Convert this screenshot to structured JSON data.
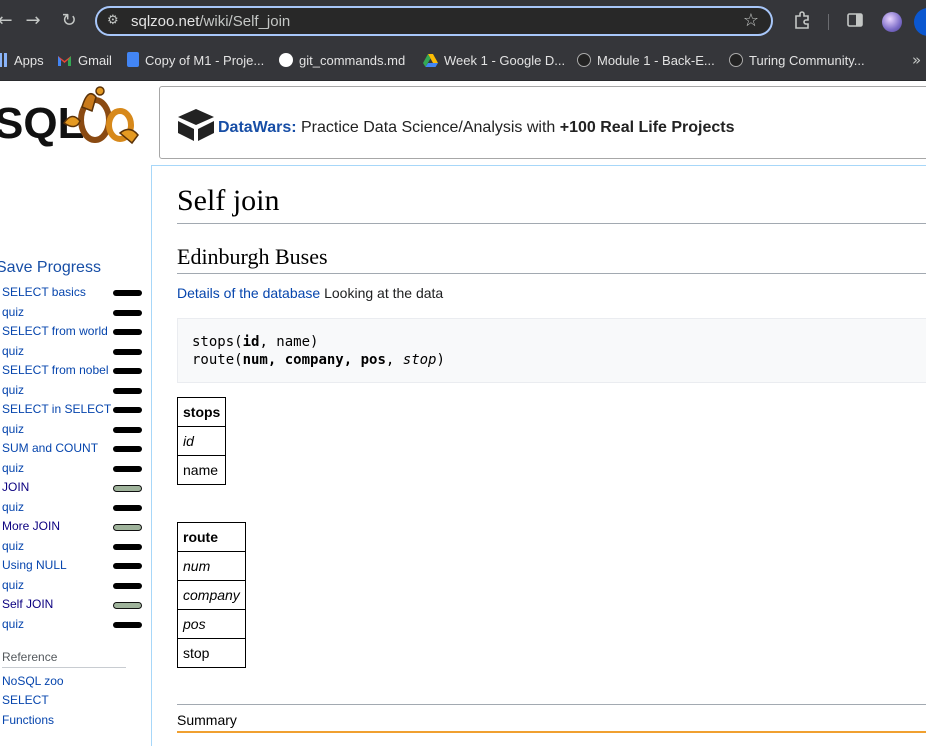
{
  "browser": {
    "url_host": "sqlzoo.net",
    "url_path": "/wiki/Self_join"
  },
  "bookmarks": [
    {
      "label": "Apps",
      "icon": "apps-grid-icon",
      "color": "#8ab4f8"
    },
    {
      "label": "Gmail",
      "icon": "gmail-icon",
      "color": "#ea4335"
    },
    {
      "label": "Copy of M1 - Proje...",
      "icon": "google-docs-icon",
      "color": "#4285f4"
    },
    {
      "label": "git_commands.md",
      "icon": "github-icon",
      "color": "#ffffff"
    },
    {
      "label": "Week 1 - Google D...",
      "icon": "google-drive-icon",
      "color": "#fbbc04"
    },
    {
      "label": "Module 1 - Back-E...",
      "icon": "turing-icon",
      "color": "#222222"
    },
    {
      "label": "Turing Community...",
      "icon": "turing-icon",
      "color": "#222222"
    }
  ],
  "banner": {
    "brand": "DataWars:",
    "text": " Practice Data Science/Analysis with ",
    "bold": "+100 Real Life Projects"
  },
  "sidebar": {
    "save_progress": "Save Progress",
    "items": [
      {
        "label": "SELECT basics",
        "status": "done"
      },
      {
        "label": "quiz",
        "status": "done"
      },
      {
        "label": "SELECT from world",
        "status": "done"
      },
      {
        "label": "quiz",
        "status": "done"
      },
      {
        "label": "SELECT from nobel",
        "status": "done"
      },
      {
        "label": "quiz",
        "status": "done"
      },
      {
        "label": "SELECT in SELECT",
        "status": "done"
      },
      {
        "label": "quiz",
        "status": "done"
      },
      {
        "label": "SUM and COUNT",
        "status": "done"
      },
      {
        "label": "quiz",
        "status": "done"
      },
      {
        "label": "JOIN",
        "status": "partial"
      },
      {
        "label": "quiz",
        "status": "done"
      },
      {
        "label": "More JOIN",
        "status": "partial"
      },
      {
        "label": "quiz",
        "status": "done"
      },
      {
        "label": "Using NULL",
        "status": "done"
      },
      {
        "label": "quiz",
        "status": "done"
      },
      {
        "label": "Self JOIN",
        "status": "partial"
      },
      {
        "label": "quiz",
        "status": "done"
      }
    ],
    "reference_title": "Reference",
    "reference_items": [
      "NoSQL zoo",
      "SELECT",
      "Functions"
    ]
  },
  "main": {
    "title": "Self join",
    "section": "Edinburgh Buses",
    "details_link": "Details of the database",
    "details_text": " Looking at the data",
    "schema_line1": {
      "table": "stops(",
      "pk": "id",
      "rest": ", name)"
    },
    "schema_line2": {
      "table": "route(",
      "k1": "num",
      "c1": ", ",
      "k2": "company",
      "c2": ", ",
      "k3": "pos",
      "c3": ", ",
      "fk": "stop",
      "end": ")"
    },
    "stops_table": {
      "header": "stops",
      "rows": [
        {
          "text": "id",
          "italic": true
        },
        {
          "text": "name",
          "italic": false
        }
      ]
    },
    "route_table": {
      "header": "route",
      "rows": [
        {
          "text": "num",
          "italic": true
        },
        {
          "text": "company",
          "italic": true
        },
        {
          "text": "pos",
          "italic": true
        },
        {
          "text": "stop",
          "italic": false
        }
      ]
    },
    "summary": "Summary"
  }
}
